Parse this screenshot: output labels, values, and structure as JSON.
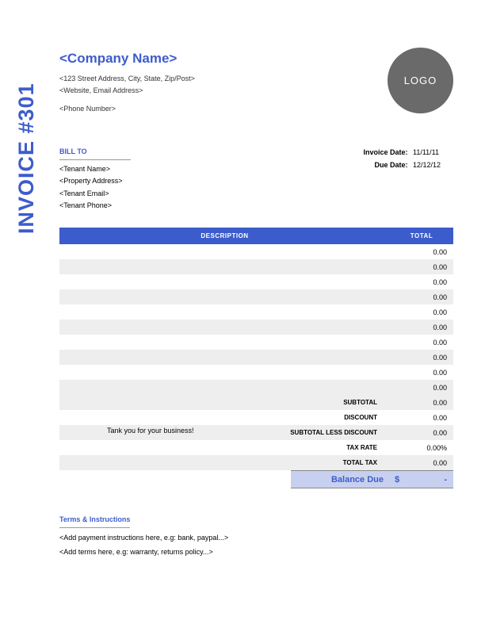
{
  "sideTitle": "INVOICE #301",
  "company": {
    "name": "<Company Name>",
    "address": "<123 Street Address, City, State, Zip/Post>",
    "webEmail": "<Website, Email Address>",
    "phone": "<Phone Number>"
  },
  "logo": "LOGO",
  "billTo": {
    "label": "BILL TO",
    "tenantName": "<Tenant Name>",
    "propertyAddress": "<Property Address>",
    "tenantEmail": "<Tenant Email>",
    "tenantPhone": "<Tenant Phone>"
  },
  "meta": {
    "invoiceDateLabel": "Invoice Date:",
    "invoiceDate": "11/11/11",
    "dueDateLabel": "Due Date:",
    "dueDate": "12/12/12"
  },
  "table": {
    "headers": {
      "description": "DESCRIPTION",
      "total": "TOTAL"
    },
    "rows": [
      {
        "desc": "",
        "total": "0.00"
      },
      {
        "desc": "",
        "total": "0.00"
      },
      {
        "desc": "",
        "total": "0.00"
      },
      {
        "desc": "",
        "total": "0.00"
      },
      {
        "desc": "",
        "total": "0.00"
      },
      {
        "desc": "",
        "total": "0.00"
      },
      {
        "desc": "",
        "total": "0.00"
      },
      {
        "desc": "",
        "total": "0.00"
      },
      {
        "desc": "",
        "total": "0.00"
      },
      {
        "desc": "",
        "total": "0.00"
      }
    ]
  },
  "summary": {
    "subtotal": {
      "label": "SUBTOTAL",
      "value": "0.00"
    },
    "discount": {
      "label": "DISCOUNT",
      "value": "0.00"
    },
    "subtotalLess": {
      "label": "SUBTOTAL LESS DISCOUNT",
      "value": "0.00"
    },
    "taxRate": {
      "label": "TAX RATE",
      "value": "0.00%"
    },
    "totalTax": {
      "label": "TOTAL TAX",
      "value": "0.00"
    }
  },
  "thankYou": "Tank you for your business!",
  "balance": {
    "label": "Balance Due",
    "currency": "$",
    "value": "-"
  },
  "terms": {
    "label": "Terms & Instructions",
    "line1": "<Add payment instructions here, e.g: bank, paypal...>",
    "line2": "<Add terms here, e.g: warranty, returns policy...>"
  }
}
